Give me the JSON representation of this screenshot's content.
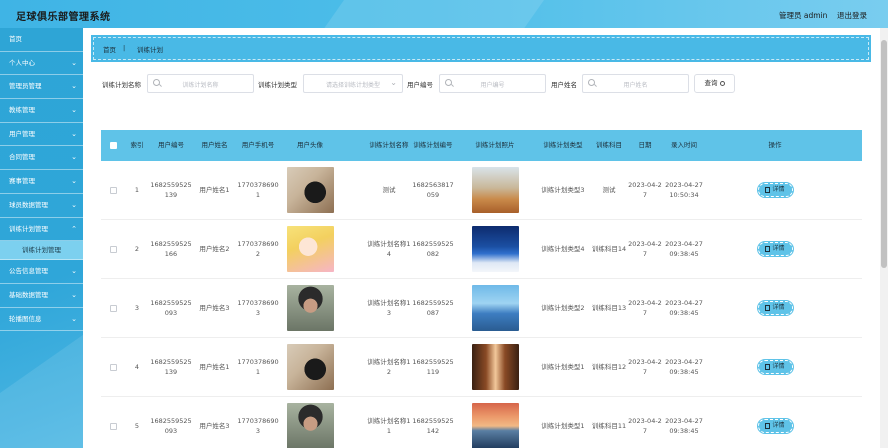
{
  "app": {
    "title": "足球俱乐部管理系统",
    "user": "管理员 admin",
    "logout": "退出登录"
  },
  "sidebar": {
    "items": [
      {
        "label": "首页",
        "chevron": false
      },
      {
        "label": "个人中心",
        "chevron": true
      },
      {
        "label": "管理员管理",
        "chevron": true
      },
      {
        "label": "教练管理",
        "chevron": true
      },
      {
        "label": "用户管理",
        "chevron": true
      },
      {
        "label": "合同管理",
        "chevron": true
      },
      {
        "label": "赛事管理",
        "chevron": true
      },
      {
        "label": "球员数据管理",
        "chevron": true
      },
      {
        "label": "训练计划管理",
        "chevron": true,
        "expanded": true,
        "children": [
          "训练计划管理"
        ]
      },
      {
        "label": "公告信息管理",
        "chevron": true
      },
      {
        "label": "基础数据管理",
        "chevron": true
      },
      {
        "label": "轮播图信息",
        "chevron": true
      }
    ]
  },
  "breadcrumb": {
    "home": "首页",
    "separator": "|",
    "current": "训练计划"
  },
  "search": {
    "plan_name_label": "训练计划名称",
    "plan_name_placeholder": "训练计划名称",
    "plan_type_label": "训练计划类型",
    "plan_type_placeholder": "请选择训练计划类型",
    "user_no_label": "用户编号",
    "user_no_placeholder": "用户编号",
    "user_name_label": "用户姓名",
    "user_name_placeholder": "用户姓名",
    "query_button": "查询"
  },
  "table": {
    "columns": [
      "索引",
      "用户编号",
      "用户姓名",
      "用户手机号",
      "用户头像",
      "训练计划名称",
      "训练计划编号",
      "训练计划照片",
      "训练计划类型",
      "训练科目",
      "日期",
      "录入时间",
      "操作"
    ],
    "detail_label": "详情",
    "rows": [
      {
        "index": "1",
        "user_no": "1682559525139",
        "user_name": "用户姓名1",
        "phone": "17703786901",
        "avatar": "av1",
        "plan_name": "测试",
        "plan_no": "1682563817059",
        "photo": "pc1",
        "plan_type": "训练计划类型3",
        "subject": "测试",
        "date": "2023-04-27",
        "created": "2023-04-27 10:50:34"
      },
      {
        "index": "2",
        "user_no": "1682559525166",
        "user_name": "用户姓名2",
        "phone": "17703786902",
        "avatar": "av2",
        "plan_name": "训练计划名称14",
        "plan_no": "1682559525082",
        "photo": "pc2",
        "plan_type": "训练计划类型4",
        "subject": "训练科目14",
        "date": "2023-04-27",
        "created": "2023-04-27 09:38:45"
      },
      {
        "index": "3",
        "user_no": "1682559525093",
        "user_name": "用户姓名3",
        "phone": "17703786903",
        "avatar": "av3",
        "plan_name": "训练计划名称13",
        "plan_no": "1682559525087",
        "photo": "pc3",
        "plan_type": "训练计划类型2",
        "subject": "训练科目13",
        "date": "2023-04-27",
        "created": "2023-04-27 09:38:45"
      },
      {
        "index": "4",
        "user_no": "1682559525139",
        "user_name": "用户姓名1",
        "phone": "17703786901",
        "avatar": "av1",
        "plan_name": "训练计划名称12",
        "plan_no": "1682559525119",
        "photo": "pc4",
        "plan_type": "训练计划类型1",
        "subject": "训练科目12",
        "date": "2023-04-27",
        "created": "2023-04-27 09:38:45"
      },
      {
        "index": "5",
        "user_no": "1682559525093",
        "user_name": "用户姓名3",
        "phone": "17703786903",
        "avatar": "av3",
        "plan_name": "训练计划名称11",
        "plan_no": "1682559525142",
        "photo": "pc5",
        "plan_type": "训练计划类型1",
        "subject": "训练科目11",
        "date": "2023-04-27",
        "created": "2023-04-27 09:38:45"
      }
    ]
  },
  "colors": {
    "header": "#4ebee9",
    "sidebar": "#2fa6d9",
    "table_header": "#5fc3e8",
    "sub_menu": "#7cd0ef"
  }
}
